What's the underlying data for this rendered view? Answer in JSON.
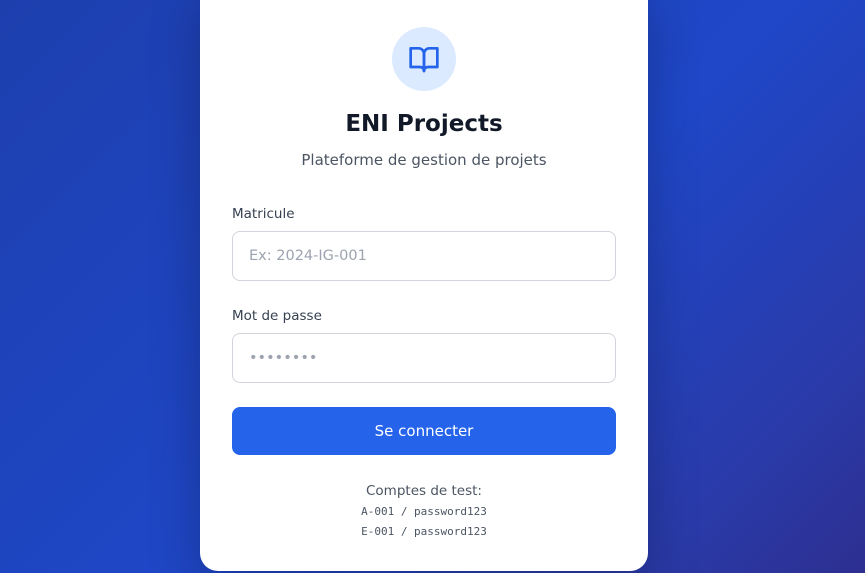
{
  "app": {
    "title": "ENI Projects",
    "subtitle": "Plateforme de gestion de projets",
    "logo_icon": "book-open-icon"
  },
  "form": {
    "matricule": {
      "label": "Matricule",
      "placeholder": "Ex: 2024-IG-001",
      "value": ""
    },
    "password": {
      "label": "Mot de passe",
      "placeholder": "••••••••",
      "value": ""
    },
    "submit_label": "Se connecter"
  },
  "test_accounts": {
    "title": "Comptes de test:",
    "accounts": [
      "A-001 / password123",
      "E-001 / password123"
    ]
  },
  "colors": {
    "primary": "#2563eb",
    "logo_bg": "#dbeafe",
    "background_gradient_start": "#1d3fae",
    "background_gradient_end": "#2d2f90"
  }
}
